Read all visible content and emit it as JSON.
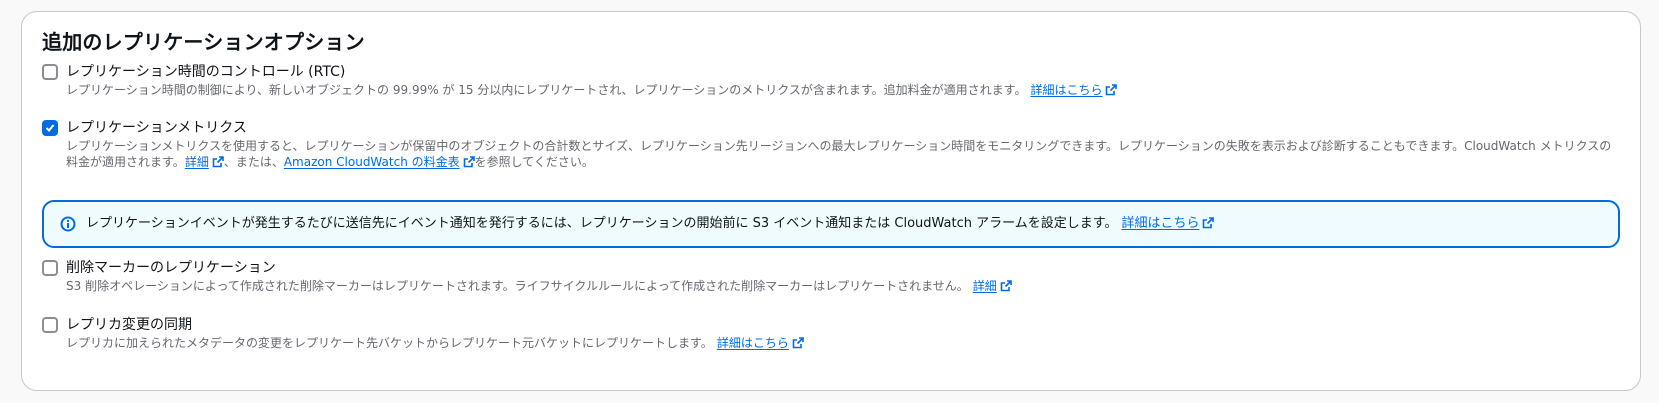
{
  "panel": {
    "title": "追加のレプリケーションオプション"
  },
  "options": {
    "rtc": {
      "checked": false,
      "label": "レプリケーション時間のコントロール (RTC)",
      "desc": "レプリケーション時間の制御により、新しいオブジェクトの 99.99% が 15 分以内にレプリケートされ、レプリケーションのメトリクスが含まれます。追加料金が適用されます。",
      "link": "詳細はこちら"
    },
    "metrics": {
      "checked": true,
      "label": "レプリケーションメトリクス",
      "desc1": "レプリケーションメトリクスを使用すると、レプリケーションが保留中のオブジェクトの合計数とサイズ、レプリケーション先リージョンへの最大レプリケーション時間をモニタリングできます。レプリケーションの失敗を表示および診断することもできます。CloudWatch メトリクスの料金が適用されます。",
      "link1": "詳細",
      "mid": "、または、",
      "link2": "Amazon CloudWatch の料金表",
      "tail": "を参照してください。"
    },
    "delete_marker": {
      "checked": false,
      "label": "削除マーカーのレプリケーション",
      "desc": "S3 削除オペレーションによって作成された削除マーカーはレプリケートされます。ライフサイクルルールによって作成された削除マーカーはレプリケートされません。",
      "link": "詳細"
    },
    "replica_sync": {
      "checked": false,
      "label": "レプリカ変更の同期",
      "desc": "レプリカに加えられたメタデータの変更をレプリケート先バケットからレプリケート元バケットにレプリケートします。",
      "link": "詳細はこちら"
    }
  },
  "info_alert": {
    "icon": "info-icon",
    "text": "レプリケーションイベントが発生するたびに送信先にイベント通知を発行するには、レプリケーションの開始前に S3 イベント通知または CloudWatch アラームを設定します。",
    "link": "詳細はこちら"
  },
  "colors": {
    "accent": "#006ce0",
    "info_bg": "#f0fbff",
    "text": "#0f141a",
    "secondary_text": "#656871"
  }
}
